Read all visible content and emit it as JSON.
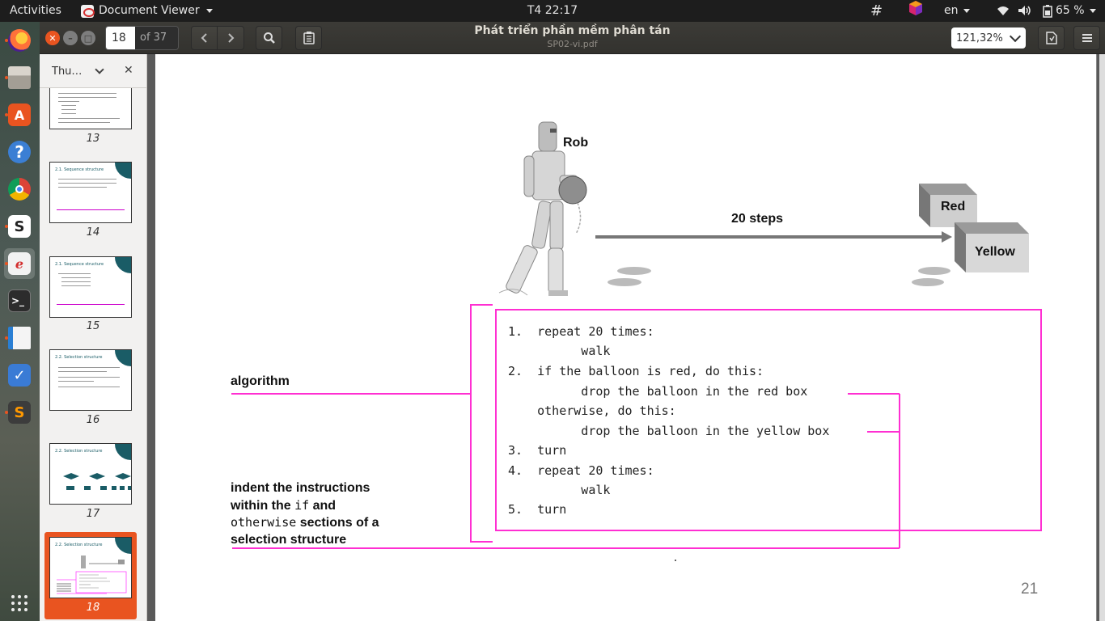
{
  "topbar": {
    "activities": "Activities",
    "app_name": "Document Viewer",
    "clock": "T4 22:17",
    "language": "en",
    "battery": "65 %"
  },
  "window": {
    "title": "Phát triển phần mềm phân tán",
    "subtitle": "SP02-vi.pdf",
    "page_current": "18",
    "page_total": "of 37",
    "zoom": "121,32%"
  },
  "sidebar": {
    "selector_label": "Thu…",
    "thumbnails": [
      {
        "num": "13",
        "title": ""
      },
      {
        "num": "14",
        "title": "2.1. Sequence structure"
      },
      {
        "num": "15",
        "title": "2.1. Sequence structure"
      },
      {
        "num": "16",
        "title": "2.2. Selection structure"
      },
      {
        "num": "17",
        "title": "2.2. Selection structure"
      },
      {
        "num": "18",
        "title": "2.2. Selection structure"
      }
    ],
    "selected": "18"
  },
  "dock": {
    "items": [
      "firefox-icon",
      "files-icon",
      "software-center-icon",
      "help-icon",
      "chrome-icon",
      "slack-icon",
      "document-viewer-icon",
      "terminal-icon",
      "libreoffice-writer-icon",
      "todo-icon",
      "sublime-icon",
      "show-apps-icon"
    ]
  },
  "page": {
    "robot_label": "Rob",
    "steps_label": "20 steps",
    "box_red": "Red",
    "box_yellow": "Yellow",
    "algorithm_label": "algorithm",
    "code_lines": [
      "1.  repeat 20 times:",
      "          walk",
      "2.  if the balloon is red, do this:",
      "          drop the balloon in the red box",
      "    otherwise, do this:",
      "          drop the balloon in the yellow box",
      "3.  turn",
      "4.  repeat 20 times:",
      "          walk",
      "5.  turn"
    ],
    "indent_note_1": "indent the instructions",
    "indent_note_2a": "within the ",
    "indent_note_2b": "if",
    "indent_note_2c": " and",
    "indent_note_3a": "otherwise",
    "indent_note_3b": " sections of a",
    "indent_note_4": "selection structure",
    "page_number": "21"
  },
  "colors": {
    "accent": "#e95420",
    "magenta": "#ff2fd2",
    "teal": "#1a5c66"
  }
}
